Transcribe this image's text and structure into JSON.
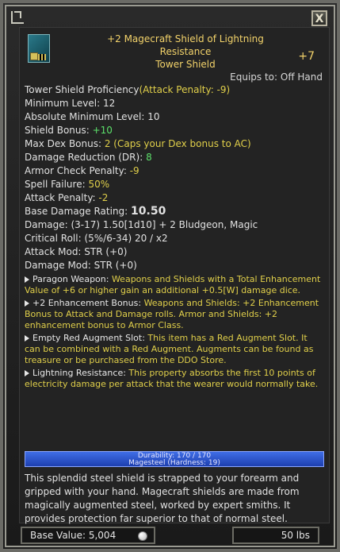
{
  "window": {
    "close_label": "X"
  },
  "item": {
    "title_line1": "+2 Magecraft Shield of Lightning",
    "title_line2": "Resistance",
    "title_line3": "Tower Shield",
    "upgrade_level": "+7",
    "equips_to": "Equips to: Off Hand",
    "icon": "tower-shield-icon"
  },
  "stats": {
    "proficiency_label": "Tower Shield Proficiency",
    "proficiency_penalty": "(Attack Penalty: -9)",
    "min_level": "Minimum Level: 12",
    "abs_min_level": "Absolute Minimum Level: 10",
    "shield_bonus_label": "Shield Bonus: ",
    "shield_bonus_value": "+10",
    "max_dex_label": "Max Dex Bonus: ",
    "max_dex_value": "2 (Caps your Dex bonus to AC)",
    "dr_label": "Damage Reduction (DR): ",
    "dr_value": "8",
    "acp_label": "Armor Check Penalty: ",
    "acp_value": "-9",
    "spell_fail_label": "Spell Failure: ",
    "spell_fail_value": "50%",
    "attack_penalty_label": "Attack Penalty: ",
    "attack_penalty_value": "-2",
    "base_damage_label": "Base Damage Rating: ",
    "base_damage_value": "10.50",
    "damage": "Damage: (3-17) 1.50[1d10] + 2 Bludgeon, Magic",
    "crit": "Critical Roll: (5%/6-34) 20 / x2",
    "attack_mod": "Attack Mod:  STR (+0)",
    "damage_mod": "Damage Mod:  STR (+0)"
  },
  "properties": [
    {
      "name": "Paragon Weapon: ",
      "desc": "Weapons and Shields with a Total Enhancement Value of +6 or higher gain an additional +0.5[W] damage dice."
    },
    {
      "name": "+2 Enhancement Bonus: ",
      "desc": "Weapons and Shields: +2 Enhancement Bonus to Attack and Damage rolls. Armor and Shields: +2 enhancement bonus to Armor Class."
    },
    {
      "name": "Empty Red Augment Slot: ",
      "desc": "This item has a Red Augment Slot. It can be combined with a Red Augment. Augments can be found as treasure or be purchased from the DDO Store."
    },
    {
      "name": "Lightning Resistance: ",
      "desc": "This property absorbs the first 10 points of electricity damage per attack that the wearer would normally take."
    }
  ],
  "durability": {
    "label": "Durability: 170 / 170",
    "material": "Magesteel (Hardness: 19)",
    "fill_fraction": 1.0
  },
  "description": "This splendid steel shield is strapped to your forearm and gripped with your hand. Magecraft shields are made from magically augmented steel, worked by expert smiths. It provides protection far superior to that of normal steel.",
  "footer": {
    "base_value": "Base Value: 5,004",
    "weight": "50 lbs",
    "coin_icon": "platinum-coin-icon"
  }
}
